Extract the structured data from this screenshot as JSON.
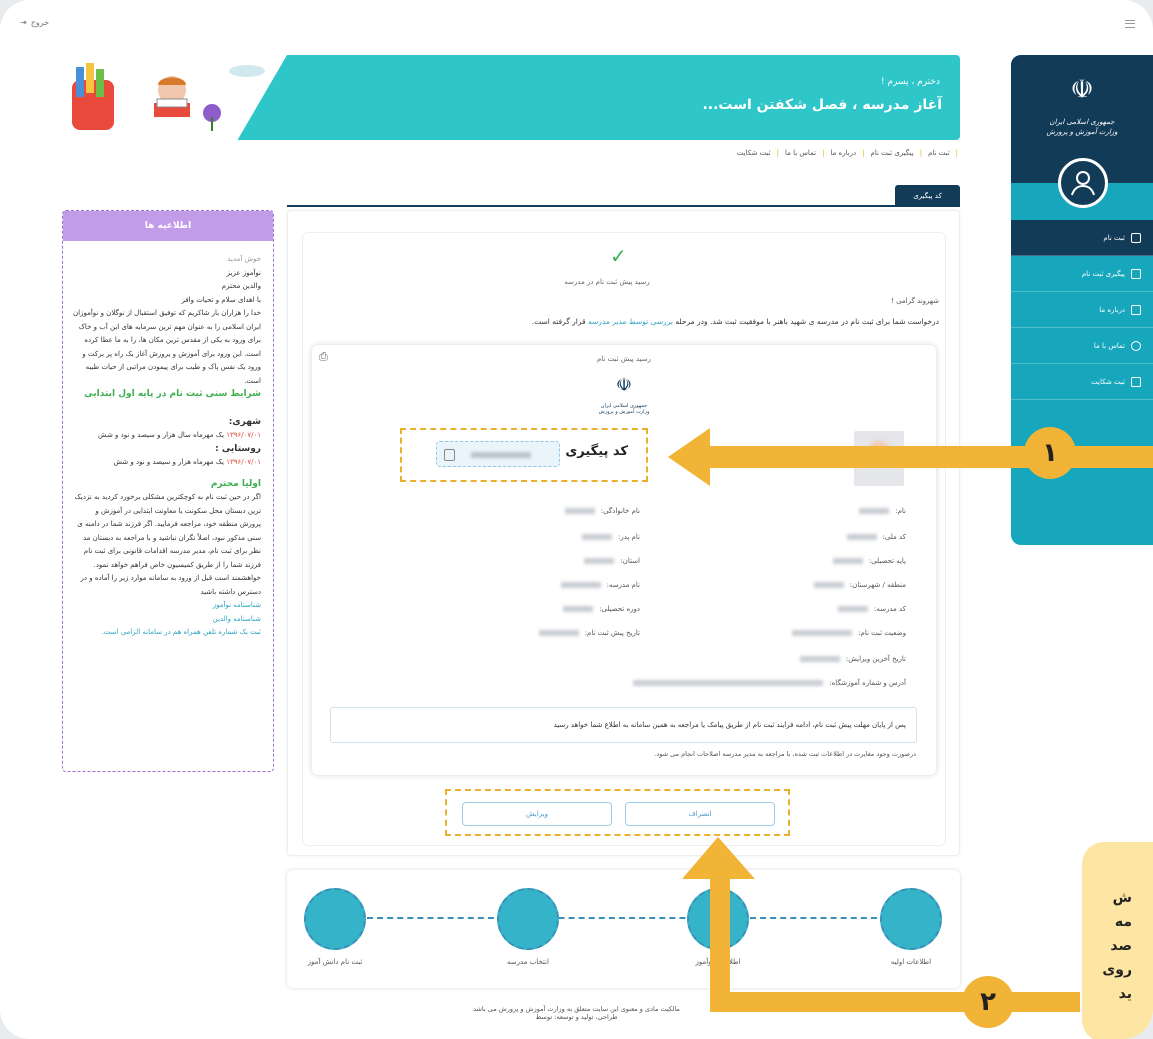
{
  "header": {
    "logout_label": "خروج"
  },
  "sidebar": {
    "org_title_line1": "جمهوری اسلامی ایران",
    "org_title_line2": "وزارت آموزش و پرورش",
    "items": [
      {
        "label": "ثبت نام",
        "icon": "check-square-icon",
        "active": true
      },
      {
        "label": "پیگیری ثبت نام",
        "icon": "graduation-cap-icon"
      },
      {
        "label": "درباره ما",
        "icon": "chat-icon"
      },
      {
        "label": "تماس با ما",
        "icon": "phone-icon"
      },
      {
        "label": "ثبت شکایت",
        "icon": "edit-icon"
      }
    ]
  },
  "banner": {
    "small": "دخترم ، پسرم !",
    "title": "آغاز مدرسه ، فصل شکفتن است..."
  },
  "topnav": [
    "ثبت نام",
    "پیگیری ثبت نام",
    "درباره ما",
    "تماس با ما",
    "ثبت شکایت"
  ],
  "tab": {
    "label": "کد پیگیری"
  },
  "main": {
    "success_text": "رسید پیش ثبت نام در مدرسه",
    "greeting": "شهروند گرامی !",
    "message_pre": "درخواست شما برای ثبت نام در مدرسه ی شهید باهنر با موفقیت ثبت شد. ودر مرحله ",
    "message_highlight": "بررسی توسط مدیر مدرسه",
    "message_post": " قرار گرفته است.",
    "receipt": {
      "title": "رسید پیش ثبت نام",
      "tracking_label": "کد پیگیری",
      "fields_right": [
        "نام:",
        "کد ملی:",
        "پایه تحصیلی:",
        "منطقه / شهرستان:",
        "کد مدرسه:",
        "وضعیت ثبت نام:",
        "تاریخ آخرین ویرایش:",
        "آدرس و شماره آموزشگاه:"
      ],
      "fields_left": [
        "نام خانوادگی:",
        "نام پدر:",
        "استان:",
        "نام مدرسه:",
        "دوره تحصیلی:",
        "تاریخ پیش ثبت نام:"
      ],
      "note": "پس از پایان مهلت پیش ثبت نام، ادامه فرایند ثبت نام از طریق پیامک یا مراجعه به همین سامانه به اطلاع شما خواهد رسید",
      "note2": "درصورت وجود مغایرت در اطلاعات ثبت شده، با مراجعه به مدیر مدرسه اصلاحات انجام می شود."
    },
    "buttons": {
      "cancel": "انصراف",
      "edit": "ویرایش"
    }
  },
  "notice": {
    "title": "اطلاعیه ها",
    "welcome": "خوش آمدید",
    "l1": "نوآموز عزیز",
    "l2": "والدین محترم",
    "l3": "با اهدای سلام و تحیات وافر",
    "para": "خدا را هزاران بار شاکریم که توفیق استقبال از نوگلان و نوآموزان ایران اسلامی را به عنوان مهم ترین سرمایه های این آب و خاک برای ورود به یکی از مقدس ترین مکان ها، را به ما عطا کرده است. این ورود برای آموزش و پرورش آغاز یک راه پر برکت و ورود یک نفس پاک و طیب برای پیمودن مراتبی از حیات طیبه است.",
    "age_title": "شرایط سنی ثبت نام در پایه اول ابتدایی",
    "urban": "شهری:",
    "urban_date": "۱۳۹۶/۰۷/۰۱",
    "urban_text": " یک مهرماه سال هزار و سیصد و نود و شش",
    "rural": "روستایی :",
    "rural_date": "۱۳۹۶/۰۷/۰۱",
    "rural_text": " یک مهرماه هزار و سیصد و نود و شش",
    "parents_title": "اولیا محترم",
    "parents_para": "اگر در حین ثبت نام به کوچکترین مشکلی برخورد کردید به نزدیک ترین دبستان محل سکونت یا معاونت ابتدایی در آموزش و پرورش منطقه خود، مراجعه فرمایید. اگر فرزند شما در دامنه ی سنی مذکور نبود، اصلاً نگران نباشید و با مراجعه به دبستان مد نظر برای ثبت نام، مدیر مدرسه اقدامات قانونی برای ثبت نام فرزند شما را از طریق کمیسیون خاص فراهم خواهد نمود. خواهشمند است قبل از ورود به سامانه موارد زیر را آماده و در دسترس داشته باشید",
    "link1": "شناسنامه نوآموز",
    "link2": "شناسنامه والدین",
    "link3": "ثبت یک شماره تلفن همراه هم در سامانه الزامی است."
  },
  "steps": [
    "اطلاعات اولیه",
    "اطلاعات نوآموز",
    "انتخاب مدرسه",
    "ثبت نام دانش آموز"
  ],
  "footer": {
    "line1": "مالکیت مادی و معنوی این سایت متعلق به وزارت آموزش و پرورش می باشد",
    "line2": "طراحی، تولید و توسعه: توسط"
  },
  "annotations": {
    "num1": "۱",
    "num2": "۲",
    "callout_lines": [
      "ش",
      "مه",
      "صد",
      "روی",
      "ید"
    ],
    "accent": "#f2b436"
  }
}
